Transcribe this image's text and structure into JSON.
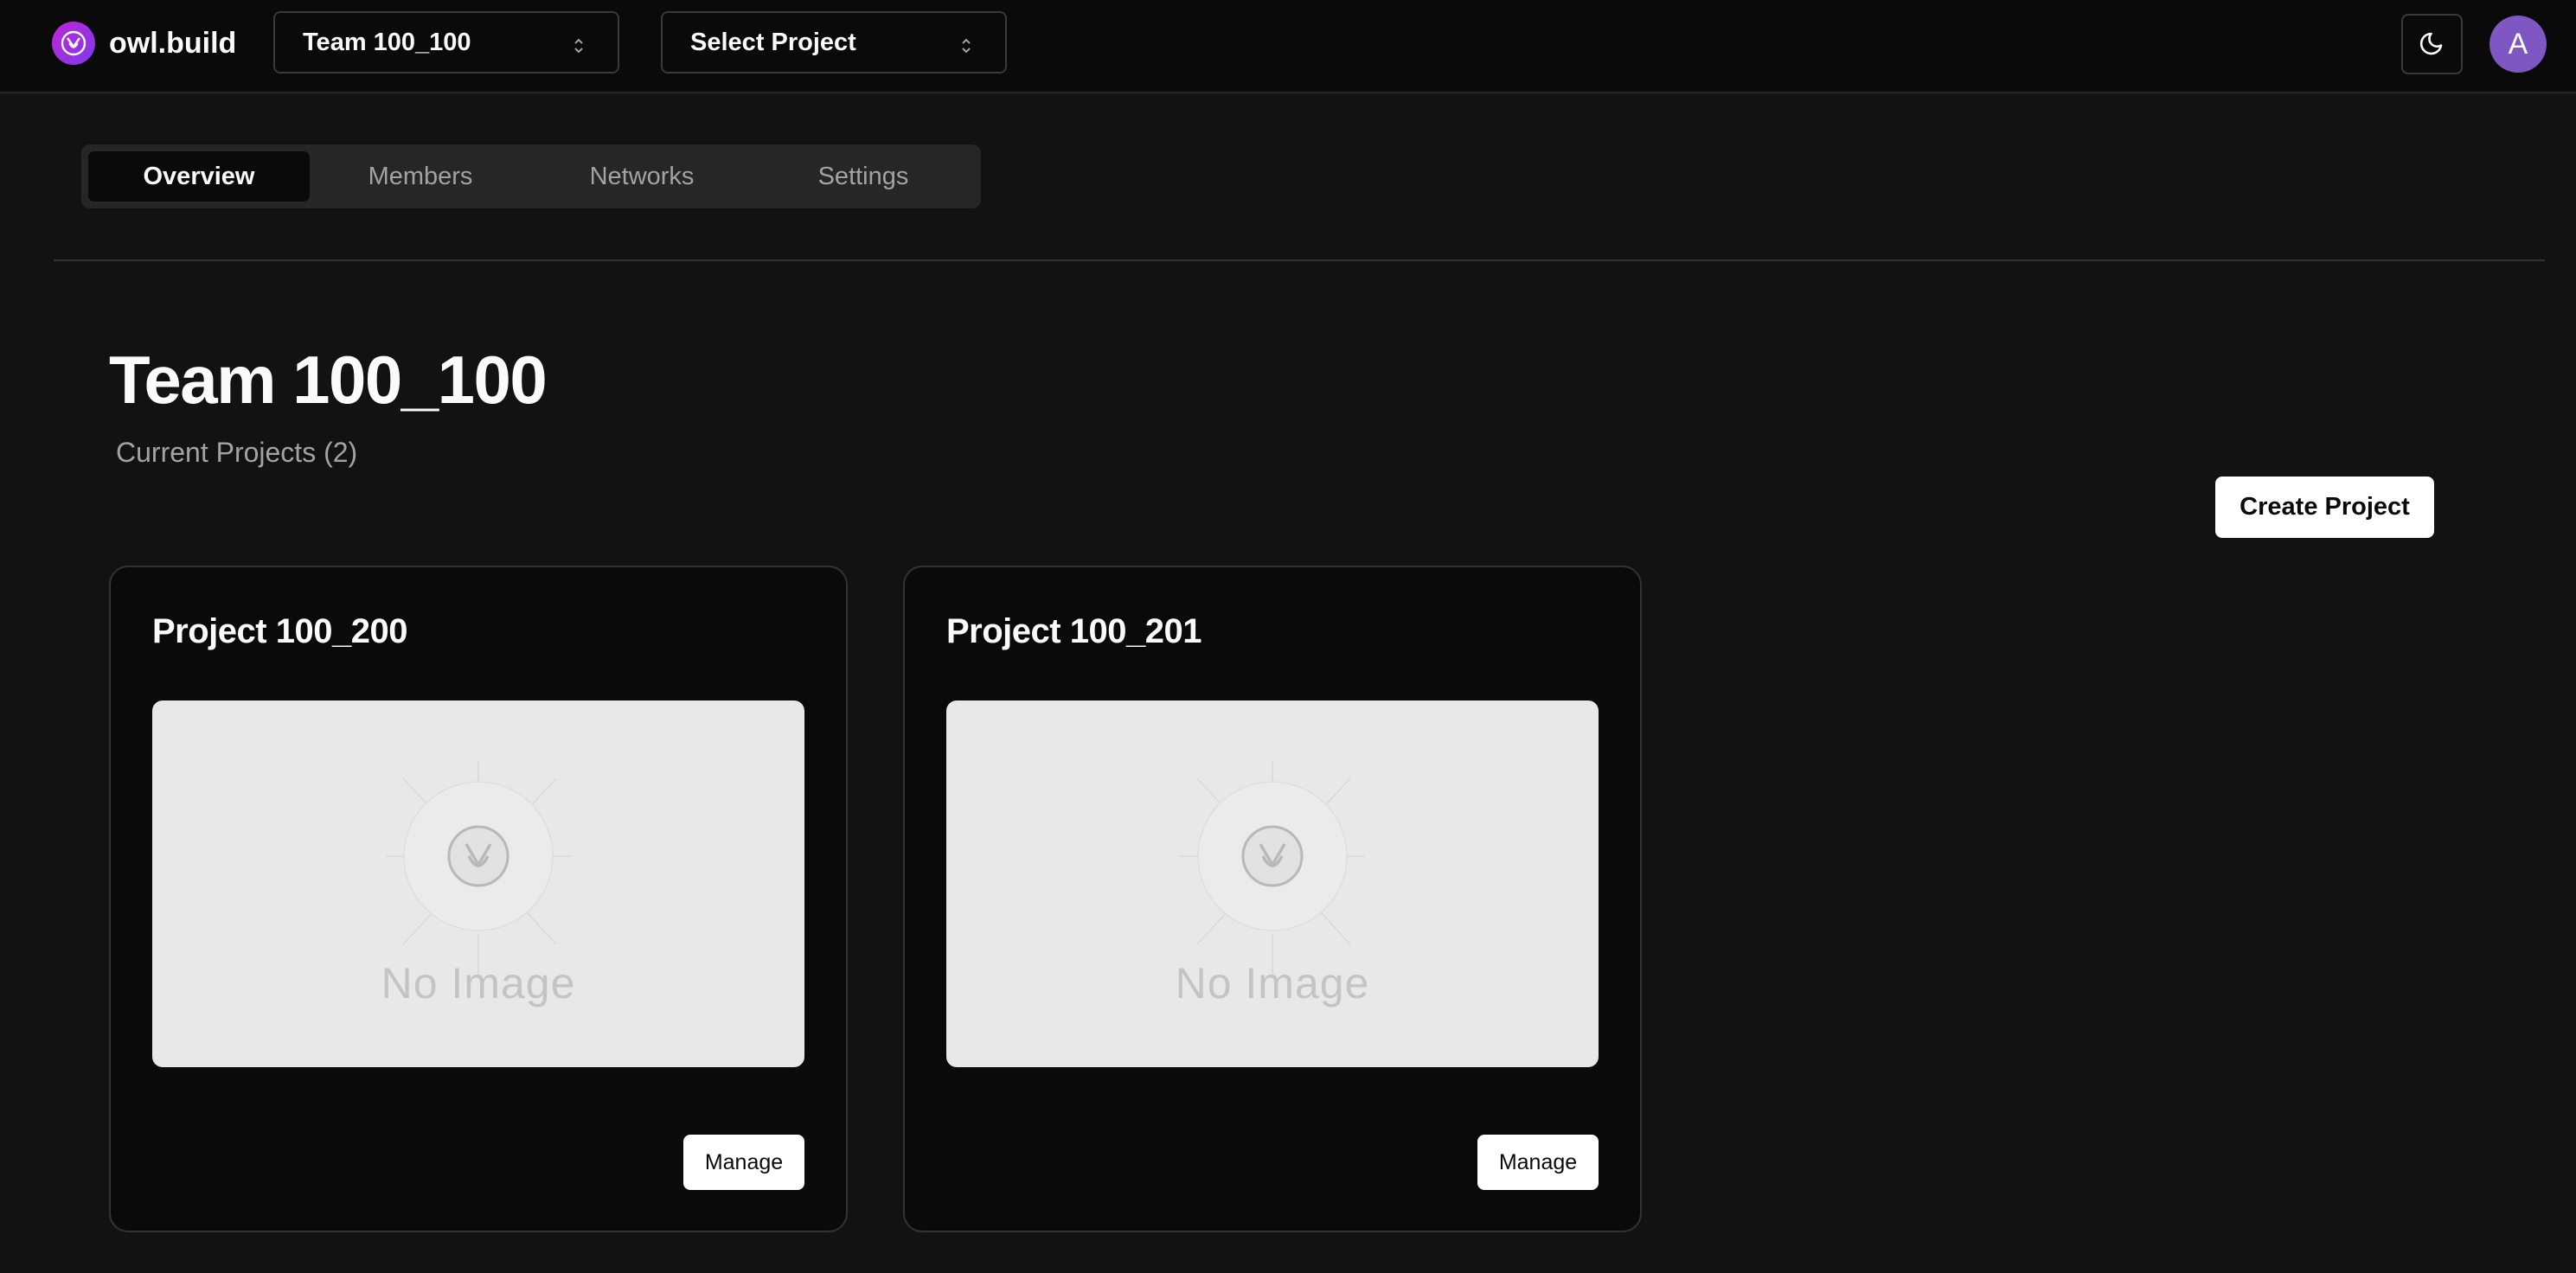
{
  "header": {
    "brand_name": "owl.build",
    "team_select": {
      "value": "Team 100_100"
    },
    "project_select": {
      "value": "Select Project"
    },
    "theme_icon": "moon-icon",
    "avatar_initial": "A",
    "avatar_color": "#7e57c2"
  },
  "tabs": [
    {
      "label": "Overview",
      "active": true
    },
    {
      "label": "Members",
      "active": false
    },
    {
      "label": "Networks",
      "active": false
    },
    {
      "label": "Settings",
      "active": false
    }
  ],
  "main": {
    "title": "Team 100_100",
    "subtitle": "Current Projects (2)",
    "create_button": "Create Project",
    "projects": [
      {
        "name": "Project 100_200",
        "image_placeholder": "No Image",
        "manage_label": "Manage"
      },
      {
        "name": "Project 100_201",
        "image_placeholder": "No Image",
        "manage_label": "Manage"
      }
    ]
  },
  "colors": {
    "background": "#121212",
    "topbar": "#0a0a0a",
    "brand_gradient_start": "#c026d3",
    "brand_gradient_end": "#7c3aed",
    "primary_button": "#ffffff"
  }
}
